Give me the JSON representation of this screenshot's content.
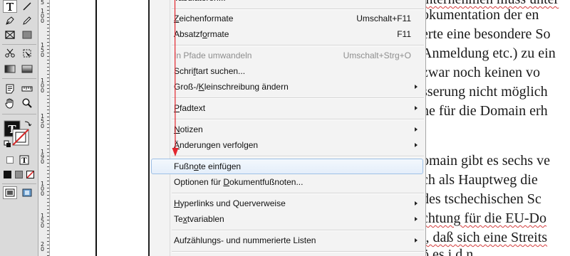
{
  "menu": {
    "top_clipped_label": "Tabulatoren...",
    "items": [
      {
        "pre": "",
        "key": "Z",
        "post": "eichenformate",
        "shortcut": "Umschalt+F11",
        "disabled": false,
        "submenu": false
      },
      {
        "pre": "Absatzf",
        "key": "o",
        "post": "rmate",
        "shortcut": "F11",
        "disabled": false,
        "submenu": false
      },
      {
        "pre": "In Pfade umwandeln",
        "key": "",
        "post": "",
        "shortcut": "Umschalt+Strg+O",
        "disabled": true,
        "submenu": false
      },
      {
        "pre": "Schri",
        "key": "f",
        "post": "tart suchen...",
        "shortcut": "",
        "disabled": false,
        "submenu": false
      },
      {
        "pre": "Groß-/",
        "key": "K",
        "post": "leinschreibung ändern",
        "shortcut": "",
        "disabled": false,
        "submenu": true
      },
      {
        "pre": "",
        "key": "P",
        "post": "fadtext",
        "shortcut": "",
        "disabled": false,
        "submenu": true
      },
      {
        "pre": "",
        "key": "N",
        "post": "otizen",
        "shortcut": "",
        "disabled": false,
        "submenu": true
      },
      {
        "pre": "",
        "key": "Ä",
        "post": "nderungen verfolgen",
        "shortcut": "",
        "disabled": false,
        "submenu": true
      },
      {
        "pre": "Fußn",
        "key": "o",
        "post": "te einfügen",
        "shortcut": "",
        "disabled": false,
        "submenu": false
      },
      {
        "pre": "Optionen für ",
        "key": "D",
        "post": "okumentfußnoten...",
        "shortcut": "",
        "disabled": false,
        "submenu": false
      },
      {
        "pre": "",
        "key": "H",
        "post": "yperlinks und Querverweise",
        "shortcut": "",
        "disabled": false,
        "submenu": true
      },
      {
        "pre": "Te",
        "key": "x",
        "post": "tvariablen",
        "shortcut": "",
        "disabled": false,
        "submenu": true
      },
      {
        "pre": "Aufzählungs- und nummerierte Listen",
        "key": "",
        "post": "",
        "shortcut": "",
        "disabled": false,
        "submenu": true
      }
    ]
  },
  "document": {
    "lines": [
      "internehmen muss unter",
      "okumentation der en",
      "erte eine besondere So",
      "Anmeldung etc.) zu ein",
      " zwar noch keinen vo",
      "sserung nicht möglich",
      "ne für die Domain erh",
      "",
      "omain gibt es sechs ve",
      "ch als Hauptweg die",
      " des tschechischen Sc",
      "chtung für die EU-Do",
      "t, daß sich eine Streits",
      "ö    es    i    d    n"
    ]
  },
  "ruler": {
    "labels": [
      "5",
      "1\n0\n0",
      "1\n5\n0",
      "1\n0\n0",
      "1\n5\n0",
      "2\n0\n0",
      "2\n5\n0",
      "1\n9\n0",
      "4\n0\n0",
      "1\n2\n0",
      "1\n5\n0"
    ]
  },
  "colors": {
    "arrow": "#e3262e",
    "highlight_border": "#9ec0e6",
    "menu_bg": "#f3f3f3"
  }
}
